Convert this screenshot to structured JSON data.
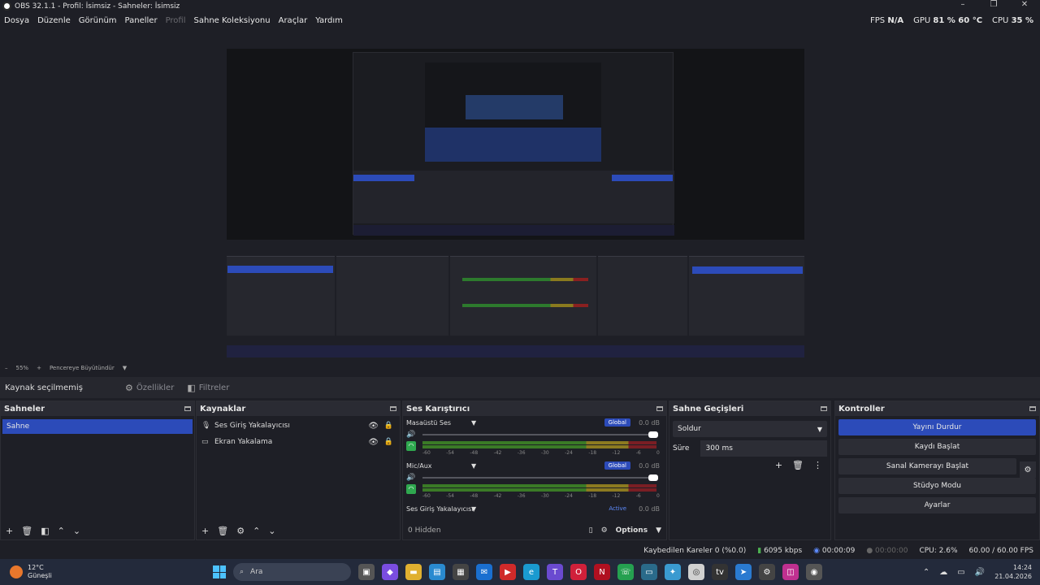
{
  "window": {
    "title": "OBS 32.1.1 - Profil: İsimsiz - Sahneler: İsimsiz",
    "controls": [
      "–",
      "❐",
      "✕"
    ]
  },
  "menu": [
    "Dosya",
    "Düzenle",
    "Görünüm",
    "Paneller",
    "Profil",
    "Sahne Koleksiyonu",
    "Araçlar",
    "Yardım"
  ],
  "stats": {
    "fps_label": "FPS",
    "fps_value": "N/A",
    "gpu_label": "GPU",
    "gpu_value": "81 % 60 °C",
    "cpu_label": "CPU",
    "cpu_value": "35 %"
  },
  "zoom": {
    "minus": "–",
    "value": "55%",
    "plus": "+",
    "fit": "Pencereye Büyütündür"
  },
  "source_toolbar": {
    "no_source": "Kaynak seçilmemiş",
    "properties": "Özellikler",
    "filters": "Filtreler"
  },
  "scenes": {
    "title": "Sahneler",
    "items": [
      "Sahne"
    ]
  },
  "sources": {
    "title": "Kaynaklar",
    "items": [
      {
        "icon": "microphone-icon",
        "label": "Ses Giriş Yakalayıcısı"
      },
      {
        "icon": "monitor-icon",
        "label": "Ekran Yakalama"
      }
    ]
  },
  "mixer": {
    "title": "Ses Karıştırıcı",
    "channels": [
      {
        "name": "Masaüstü Ses",
        "badge": "Global",
        "db": "0.0 dB"
      },
      {
        "name": "Mic/Aux",
        "badge": "Global",
        "db": "0.0 dB"
      },
      {
        "name": "Ses Giriş Yakalayıcısı",
        "badge": "Active",
        "db": "0.0 dB"
      }
    ],
    "ticks": [
      "-60",
      "-54",
      "-48",
      "-42",
      "-36",
      "-30",
      "-24",
      "-18",
      "-12",
      "-6",
      "0"
    ],
    "hidden": "0 Hidden",
    "options": "Options"
  },
  "transitions": {
    "title": "Sahne Geçişleri",
    "type": "Soldur",
    "duration_label": "Süre",
    "duration_value": "300 ms"
  },
  "controls": {
    "title": "Kontroller",
    "stop_stream": "Yayını Durdur",
    "start_recording": "Kaydı Başlat",
    "virtual_camera": "Sanal Kamerayı Başlat",
    "studio_mode": "Stüdyo Modu",
    "settings": "Ayarlar"
  },
  "statusbar": {
    "dropped": "Kaybedilen Kareler 0 (%0.0)",
    "bitrate": "6095 kbps",
    "stream_time": "00:00:09",
    "rec_time": "00:00:00",
    "cpu": "CPU: 2.6%",
    "fps": "60.00 / 60.00 FPS"
  },
  "taskbar": {
    "temp": "12°C",
    "weather": "Güneşli",
    "search": "Ara",
    "time": "14:24",
    "date": "21.04.2026"
  },
  "colors": {
    "accent": "#2c4bb9",
    "bg": "#1e1f26",
    "panel": "#2a2b33"
  }
}
